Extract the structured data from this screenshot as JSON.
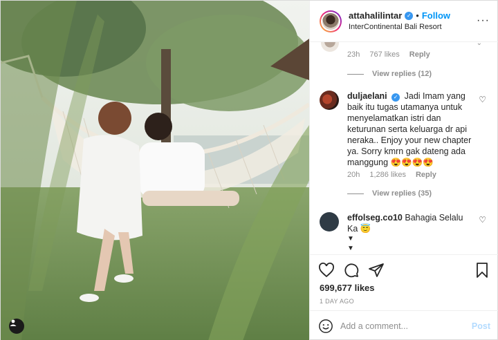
{
  "post": {
    "username": "attahalilintar",
    "follow_label": "Follow",
    "location": "InterContinental Bali Resort",
    "more_glyph": "···"
  },
  "comments": {
    "prev_meta": {
      "time": "23h",
      "likes": "767 likes",
      "reply": "Reply"
    },
    "prev_view_replies": "View replies (12)",
    "items": [
      {
        "username": "duljaelani",
        "text": "Jadi Imam yang baik itu tugas utamanya untuk menyelamatkan istri dan keturunan serta keluarga dr api neraka.. Enjoy your new chapter ya. Sorry kmrn gak dateng ada manggung 😍😍😍😍",
        "time": "20h",
        "likes": "1,286 likes",
        "reply": "Reply",
        "view_replies": "View replies (35)"
      },
      {
        "username": "effolseg.co10",
        "text": "Bahagia Selalu Ka 😇",
        "arrows": [
          "▼",
          "▼"
        ]
      }
    ]
  },
  "actions": {
    "likes": "699,677 likes",
    "time_ago": "1 DAY AGO"
  },
  "composer": {
    "placeholder": "Add a comment...",
    "post_label": "Post"
  },
  "icons": [
    "user-tag-icon",
    "verified-badge-icon",
    "more-options-icon",
    "heart-icon",
    "comment-icon",
    "share-icon",
    "bookmark-icon",
    "emoji-icon"
  ],
  "colors": {
    "accent": "#0095f6",
    "verified": "#3897f0",
    "post_disabled": "#b3dbff",
    "muted": "#8e8e8e"
  }
}
